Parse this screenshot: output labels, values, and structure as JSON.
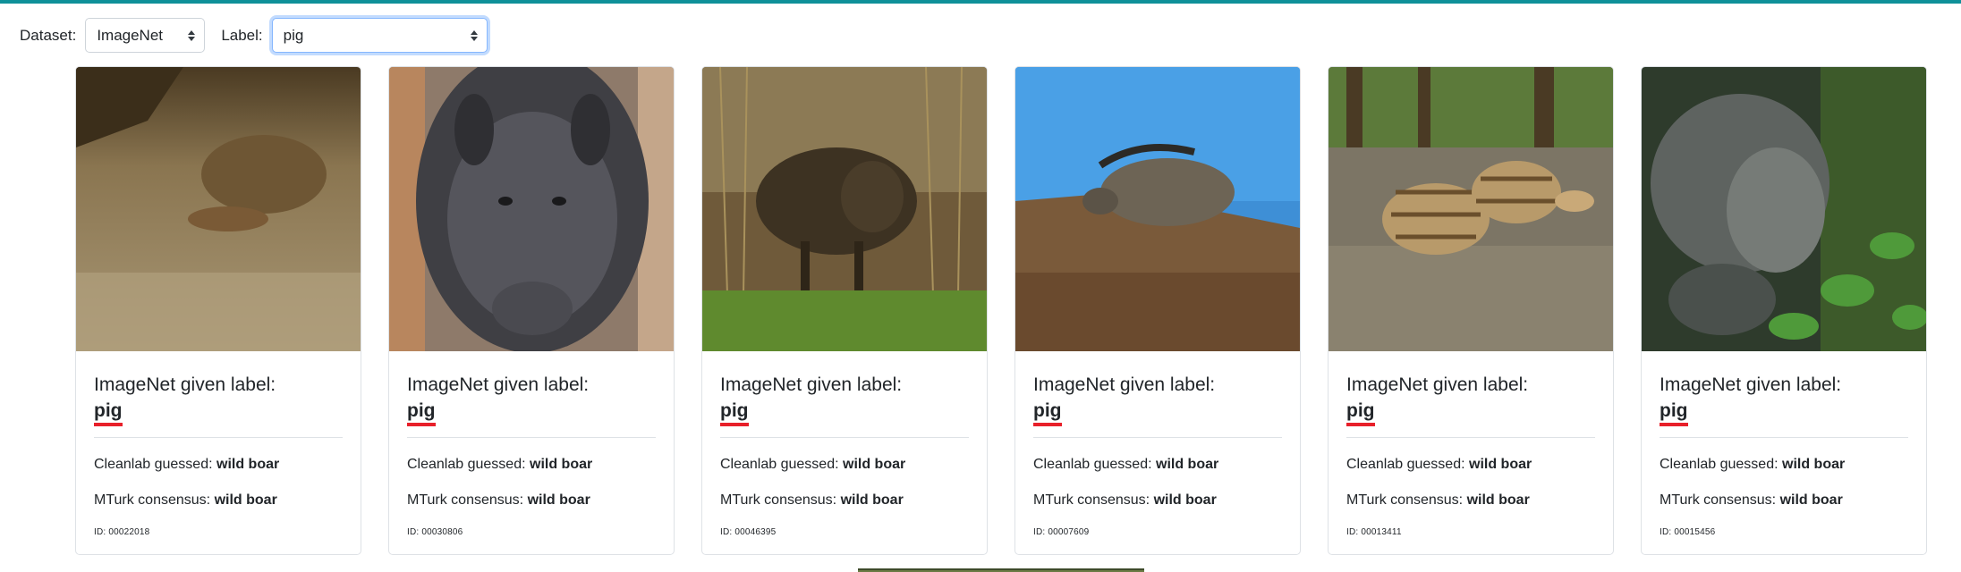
{
  "accent_color": "#0f9099",
  "filters": {
    "dataset_label": "Dataset:",
    "dataset_value": "ImageNet",
    "label_label": "Label:",
    "label_value": "pig"
  },
  "cards": [
    {
      "given_prefix": "ImageNet given label:",
      "given_label": "pig",
      "cleanlab_prefix": "Cleanlab guessed:",
      "cleanlab_value": "wild boar",
      "mturk_prefix": "MTurk consensus:",
      "mturk_value": "wild boar",
      "id": "ID: 00022018"
    },
    {
      "given_prefix": "ImageNet given label:",
      "given_label": "pig",
      "cleanlab_prefix": "Cleanlab guessed:",
      "cleanlab_value": "wild boar",
      "mturk_prefix": "MTurk consensus:",
      "mturk_value": "wild boar",
      "id": "ID: 00030806"
    },
    {
      "given_prefix": "ImageNet given label:",
      "given_label": "pig",
      "cleanlab_prefix": "Cleanlab guessed:",
      "cleanlab_value": "wild boar",
      "mturk_prefix": "MTurk consensus:",
      "mturk_value": "wild boar",
      "id": "ID: 00046395"
    },
    {
      "given_prefix": "ImageNet given label:",
      "given_label": "pig",
      "cleanlab_prefix": "Cleanlab guessed:",
      "cleanlab_value": "wild boar",
      "mturk_prefix": "MTurk consensus:",
      "mturk_value": "wild boar",
      "id": "ID: 00007609"
    },
    {
      "given_prefix": "ImageNet given label:",
      "given_label": "pig",
      "cleanlab_prefix": "Cleanlab guessed:",
      "cleanlab_value": "wild boar",
      "mturk_prefix": "MTurk consensus:",
      "mturk_value": "wild boar",
      "id": "ID: 00013411"
    },
    {
      "given_prefix": "ImageNet given label:",
      "given_label": "pig",
      "cleanlab_prefix": "Cleanlab guessed:",
      "cleanlab_value": "wild boar",
      "mturk_prefix": "MTurk consensus:",
      "mturk_value": "wild boar",
      "id": "ID: 00015456"
    }
  ]
}
